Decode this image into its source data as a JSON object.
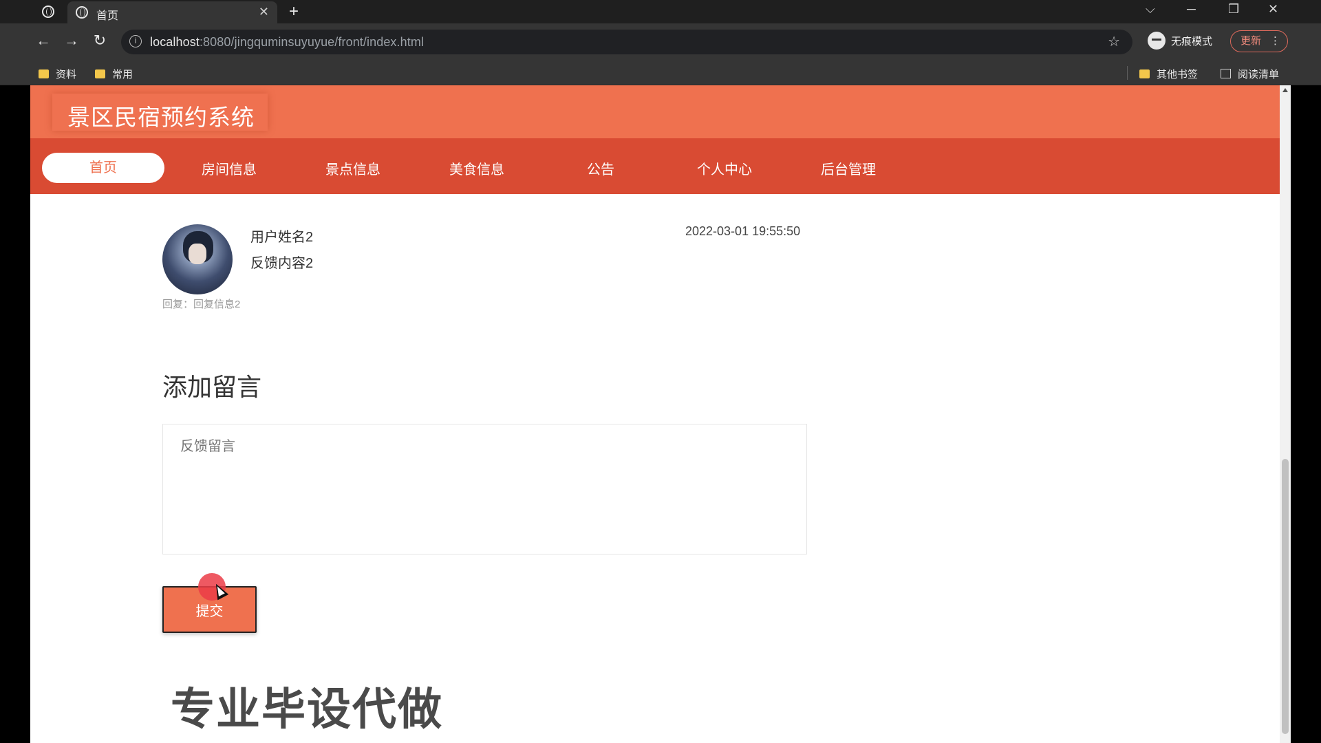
{
  "browser": {
    "tab_title": "首页",
    "url_host": "localhost",
    "url_path": ":8080/jingquminsuyuyue/front/index.html",
    "incognito_label": "无痕模式",
    "update_label": "更新",
    "bookmarks": [
      {
        "label": "资料"
      },
      {
        "label": "常用"
      }
    ],
    "other_bookmarks": "其他书签",
    "reading_list": "阅读清单"
  },
  "site": {
    "title": "景区民宿预约系统",
    "nav": [
      {
        "label": "首页",
        "active": true
      },
      {
        "label": "房间信息"
      },
      {
        "label": "景点信息"
      },
      {
        "label": "美食信息"
      },
      {
        "label": "公告"
      },
      {
        "label": "个人中心"
      },
      {
        "label": "后台管理"
      }
    ]
  },
  "feedback": {
    "user_name": "用户姓名2",
    "content": "反馈内容2",
    "time": "2022-03-01 19:55:50",
    "reply": "回复：回复信息2"
  },
  "add_message": {
    "title": "添加留言",
    "placeholder": "反馈留言",
    "submit_label": "提交"
  },
  "watermark": "专业毕设代做",
  "colors": {
    "header": "#ef714f",
    "nav": "#d94b33",
    "accent": "#ef714f"
  }
}
